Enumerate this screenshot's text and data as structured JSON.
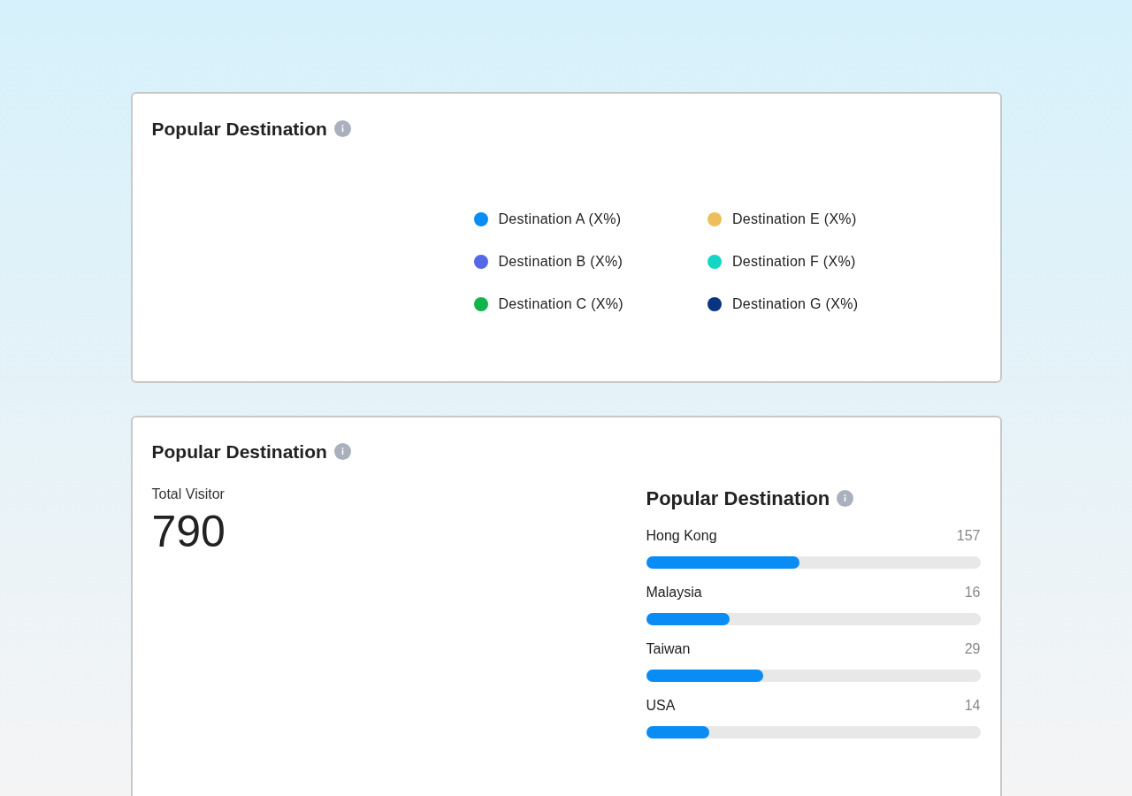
{
  "legend_card": {
    "title": "Popular Destination",
    "legend": [
      {
        "label": "Destination A (X%)",
        "color": "#0a8cf5"
      },
      {
        "label": "Destination B (X%)",
        "color": "#5468e8"
      },
      {
        "label": "Destination C (X%)",
        "color": "#12b54c"
      },
      {
        "label": "Destination E (X%)",
        "color": "#ecbf5a"
      },
      {
        "label": "Destination F (X%)",
        "color": "#14d6c4"
      },
      {
        "label": "Destination G (X%)",
        "color": "#0a3382"
      }
    ]
  },
  "visitor_card": {
    "title": "Popular Destination",
    "total_label": "Total Visitor",
    "total_value": "790",
    "ranking": {
      "title": "Popular Destination",
      "items": [
        {
          "name": "Hong Kong",
          "count": "157",
          "level": 0.46
        },
        {
          "name": "Malaysia",
          "count": "16",
          "level": 0.25
        },
        {
          "name": "Taiwan",
          "count": "29",
          "level": 0.35
        },
        {
          "name": "USA",
          "count": "14",
          "level": 0.19
        }
      ]
    }
  }
}
